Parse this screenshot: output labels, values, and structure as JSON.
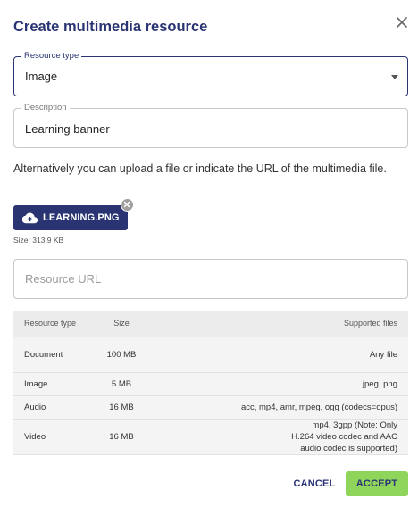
{
  "dialog": {
    "title": "Create multimedia resource"
  },
  "resource_type": {
    "legend": "Resource type",
    "value": "Image"
  },
  "description": {
    "legend": "Description",
    "value": "Learning banner"
  },
  "helper_text": "Alternatively you can upload a file or indicate the URL of the multimedia file.",
  "upload": {
    "file_name": "LEARNING.PNG",
    "size_text": "Size: 313.9 KB"
  },
  "url_field": {
    "placeholder": "Resource URL",
    "value": ""
  },
  "formats_table": {
    "headers": [
      "Resource type",
      "Size",
      "Supported files"
    ],
    "rows": [
      {
        "type": "Document",
        "size": "100 MB",
        "files": "Any file"
      },
      {
        "type": "Image",
        "size": "5 MB",
        "files": "jpeg, png"
      },
      {
        "type": "Audio",
        "size": "16 MB",
        "files": "acc, mp4, amr, mpeg, ogg (codecs=opus)"
      },
      {
        "type": "Video",
        "size": "16 MB",
        "files": "mp4, 3gpp (Note: Only H.264 video codec and AAC audio codec is supported)"
      }
    ]
  },
  "actions": {
    "cancel_label": "CANCEL",
    "accept_label": "ACCEPT"
  },
  "colors": {
    "primary": "#2a3473",
    "accept": "#8fd45b",
    "table_header": "#ececec",
    "table_row": "#f4f4f4"
  }
}
